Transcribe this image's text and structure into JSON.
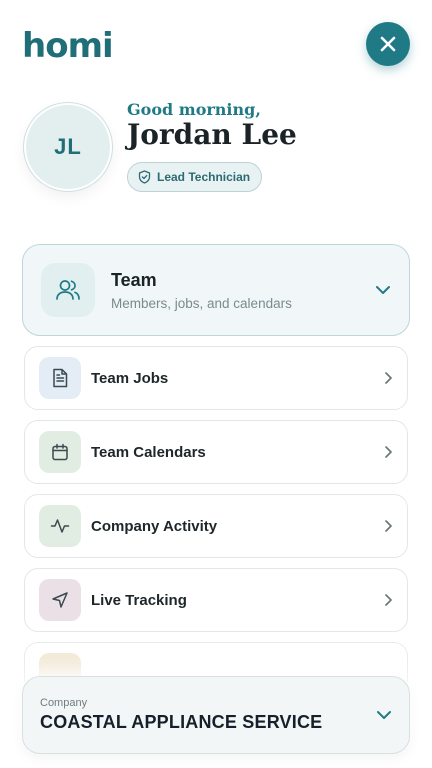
{
  "app": {
    "logo_text": "homi"
  },
  "header": {
    "close_icon": "close-icon"
  },
  "profile": {
    "initials": "JL",
    "greeting": "Good morning,",
    "name": "Jordan Lee",
    "role": "Lead Technician",
    "role_icon": "shield-check-icon"
  },
  "team_section": {
    "title": "Team",
    "subtitle": "Members, jobs, and calendars",
    "icon": "users-icon",
    "expanded": true
  },
  "menu": {
    "items": [
      {
        "label": "Team Jobs",
        "icon": "document-icon",
        "icon_bg": "#e4edf5"
      },
      {
        "label": "Team Calendars",
        "icon": "calendar-icon",
        "icon_bg": "#e1ede3"
      },
      {
        "label": "Company Activity",
        "icon": "activity-icon",
        "icon_bg": "#e1ede3"
      },
      {
        "label": "Live Tracking",
        "icon": "navigation-icon",
        "icon_bg": "#ebe0e6"
      }
    ],
    "partial_item_icon_bg": "#f3ead9"
  },
  "company": {
    "label": "Company",
    "name": "COASTAL APPLIANCE SERVICE"
  },
  "colors": {
    "brand": "#1f7a86",
    "text_dark": "#1b2326",
    "muted": "#7a8a8e"
  }
}
